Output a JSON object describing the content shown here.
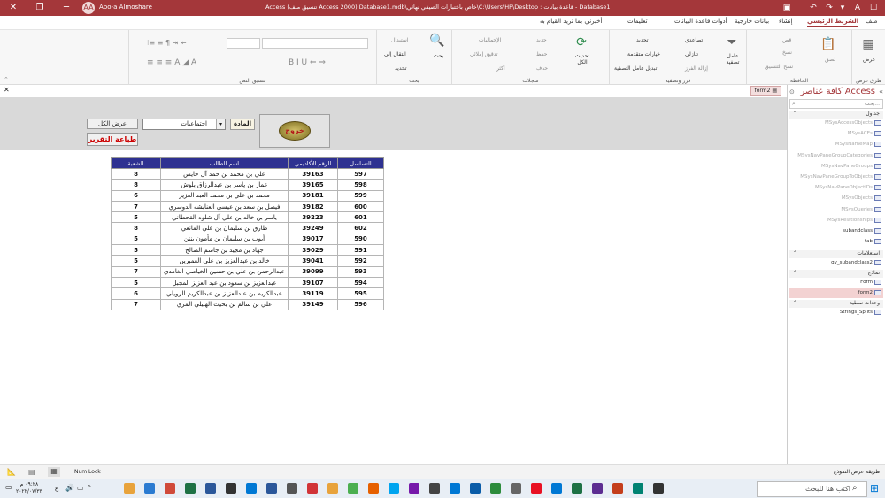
{
  "titlebar": {
    "title": "Access    (تنسيق ملف Access 2000) Database1.mdb\\خاص باختبارات الصيفي نهائي\\C:\\Users\\HP\\Desktop : قاعدة بيانات - Database1",
    "user": "Abo-a Almoshare",
    "avatar_initials": "AA"
  },
  "menu": {
    "tabs": [
      "ملف",
      "الشريط الرئيسي",
      "إنشاء",
      "بيانات خارجية",
      "أدوات قاعدة البيانات",
      "تعليمات"
    ],
    "active_tab": "الشريط الرئيسي",
    "tell_me": "أخبرني بما تريد القيام به"
  },
  "ribbon": {
    "groups": {
      "views": "طرق عرض",
      "clipboard": "الحافظة",
      "sort_filter": "فرز وتصفية",
      "records": "سجلات",
      "find": "بحث",
      "text_format": "تنسيق النص"
    },
    "view_btn": "عرض",
    "paste": "لصق",
    "cut": "قص",
    "copy": "نسخ",
    "format_painter": "نسخ التنسيق",
    "filter": "عامل تصفية",
    "ascending": "تصاعدي",
    "descending": "تنازلي",
    "remove_sort": "إزالة الفرز",
    "selection": "تحديد",
    "advanced": "خيارات متقدمة",
    "toggle_filter": "تبديل عامل التصفية",
    "refresh_all": "تحديث الكل",
    "new": "جديد",
    "save": "حفظ",
    "delete": "حذف",
    "totals": "الإجماليات",
    "spelling": "تدقيق إملائي",
    "more": "أكثر",
    "find_btn": "بحث",
    "replace": "استبدال",
    "goto": "انتقال إلى",
    "select_btn": "تحديد"
  },
  "document": {
    "tab_label": "form2"
  },
  "form": {
    "exit_label": "خروج",
    "subject_label": "المادة",
    "subject_value": "اجتماعيات",
    "show_all_label": "عرض الكل",
    "print_label": "طباعة التقرير",
    "columns": [
      "التسلسل",
      "الرقم الأكاديمي",
      "اسم الطالب",
      "الشعبة"
    ],
    "rows": [
      [
        "597",
        "39163",
        "علي بن محمد بن حمد آل حايس",
        "8"
      ],
      [
        "598",
        "39165",
        "عمار بن ياسر بن عبدالرزاق بلوش",
        "8"
      ],
      [
        "599",
        "39181",
        "محمد بن علي بن محمد العبد العزيز",
        "6"
      ],
      [
        "600",
        "39182",
        "فيصل بن سعد بن عيسى العنابشه الدوسري",
        "7"
      ],
      [
        "601",
        "39223",
        "ياسر بن خالد بن علي آل شلوه القحطاني",
        "5"
      ],
      [
        "602",
        "39249",
        "طارق بن سليمان بن علي المانعي",
        "8"
      ],
      [
        "590",
        "39017",
        "أيوب بن سليمان بن مأمون بنتن",
        "5"
      ],
      [
        "591",
        "39029",
        "جهاد بن مجيد بن جاسم الصالح",
        "5"
      ],
      [
        "592",
        "39041",
        "خالد بن عبدالعزيز بن علي العمبرين",
        "5"
      ],
      [
        "593",
        "39099",
        "عبدالرحمن بن علي بن حسين الخياصي الغامدي",
        "7"
      ],
      [
        "594",
        "39107",
        "عبدالعزيز بن سعود بن عبد العزيز المجبل",
        "5"
      ],
      [
        "595",
        "39119",
        "عبدالكريم بن عبدالعزيز بن عبدالكريم الرويلي",
        "6"
      ],
      [
        "596",
        "39149",
        "علي بن سالم بن بخيت الهنيلي المري",
        "7"
      ]
    ]
  },
  "nav": {
    "title": "كافة عناصر Access",
    "search_placeholder": "بحث...",
    "sections": {
      "tables": "جداول",
      "queries": "استعلامات",
      "forms": "نماذج",
      "modules": "وحدات نمطية"
    },
    "tables": [
      "MSysAccessObjects",
      "MSysACEs",
      "MSysNameMap",
      "MSysNavPaneGroupCategories",
      "MSysNavPaneGroups",
      "MSysNavPaneGroupToObjects",
      "MSysNavPaneObjectIDs",
      "MSysObjects",
      "MSysQueries",
      "MSysRelationships",
      "subandclass",
      "tab"
    ],
    "queries": [
      "qy_subandclass2"
    ],
    "forms": [
      "Form",
      "form2"
    ],
    "modules": [
      "Strings_Splits"
    ]
  },
  "status": {
    "num_lock": "Num Lock",
    "view_name": "طريقة عرض النموذج"
  },
  "taskbar": {
    "search": "اكتب هنا للبحث",
    "time": "٠٩:٢٨ م",
    "date": "٢٠٢٢/٠٧/٣٣",
    "lang": "ع"
  },
  "colors": {
    "accent": "#a4373a",
    "table_header": "#2e3191"
  }
}
